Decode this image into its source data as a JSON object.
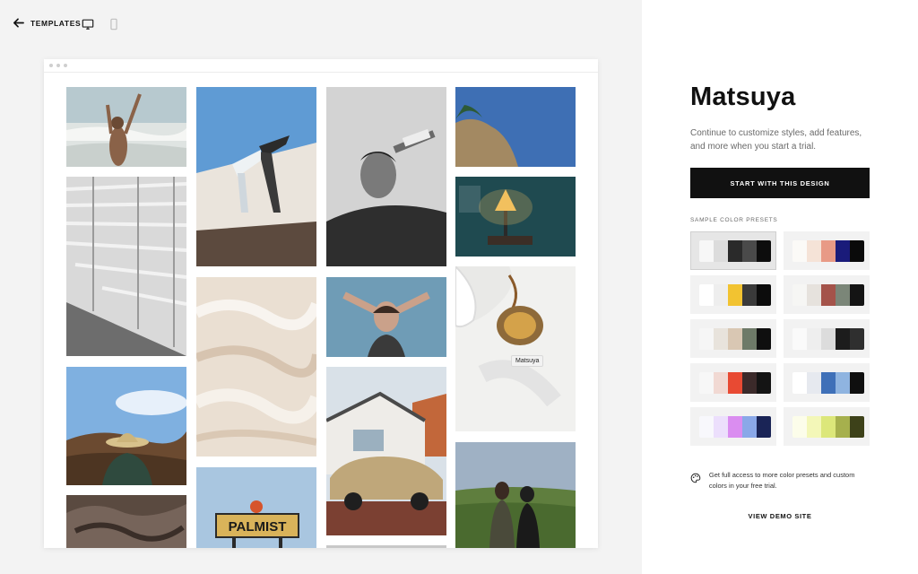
{
  "topbar": {
    "back_label": "TEMPLATES",
    "devices": [
      "desktop-icon",
      "mobile-icon"
    ]
  },
  "preview": {
    "tooltip": "Matsuya",
    "photos": [
      "beach-jump",
      "stadium-bleachers",
      "desert-hat",
      "lava-rock",
      "wall-climb",
      "white-terraces",
      "palmist-sign",
      "man-water-bottle",
      "woman-sunlight",
      "vintage-car",
      "cliff-sky",
      "lamp-interior",
      "tea-pour",
      "couple-field"
    ],
    "sign_text": "PALMIST"
  },
  "panel": {
    "title": "Matsuya",
    "description": "Continue to customize styles, add features, and more when you start a trial.",
    "cta_label": "START WITH THIS DESIGN",
    "presets_label": "SAMPLE COLOR PRESETS",
    "note_text": "Get full access to more color presets and custom colors in your free trial.",
    "demo_label": "VIEW DEMO SITE"
  },
  "presets": [
    {
      "selected": true,
      "colors": [
        "#f7f7f7",
        "#dcdcdc",
        "#2a2a2a",
        "#4a4a4a",
        "#0d0d0d"
      ]
    },
    {
      "selected": false,
      "colors": [
        "#fbfaf7",
        "#f5e3d7",
        "#e89a86",
        "#1a1b7a",
        "#0a0a0a"
      ]
    },
    {
      "selected": false,
      "colors": [
        "#ffffff",
        "#eeeeee",
        "#f2c331",
        "#3a3a3a",
        "#0c0c0c"
      ]
    },
    {
      "selected": false,
      "colors": [
        "#f6f6f4",
        "#e6e2dd",
        "#a4534a",
        "#7b8678",
        "#141414"
      ]
    },
    {
      "selected": false,
      "colors": [
        "#f6f6f6",
        "#e8e3dc",
        "#d9c7b3",
        "#6e7a68",
        "#0f0f0f"
      ]
    },
    {
      "selected": false,
      "colors": [
        "#fafafa",
        "#eeeeee",
        "#dcdcdc",
        "#1c1c1c",
        "#2f2f2f"
      ]
    },
    {
      "selected": false,
      "colors": [
        "#f7f7f7",
        "#f1d9d3",
        "#e84a33",
        "#3b2a2a",
        "#141414"
      ]
    },
    {
      "selected": false,
      "colors": [
        "#ffffff",
        "#e6e9ef",
        "#3f70b8",
        "#8fb4e0",
        "#0f0f0f"
      ]
    },
    {
      "selected": false,
      "colors": [
        "#f8f8fc",
        "#ecdffc",
        "#da8df0",
        "#8aa8e8",
        "#1a2456"
      ]
    },
    {
      "selected": false,
      "colors": [
        "#fcfdea",
        "#f3f7b8",
        "#dce77a",
        "#a6b04d",
        "#3d4119"
      ]
    }
  ]
}
